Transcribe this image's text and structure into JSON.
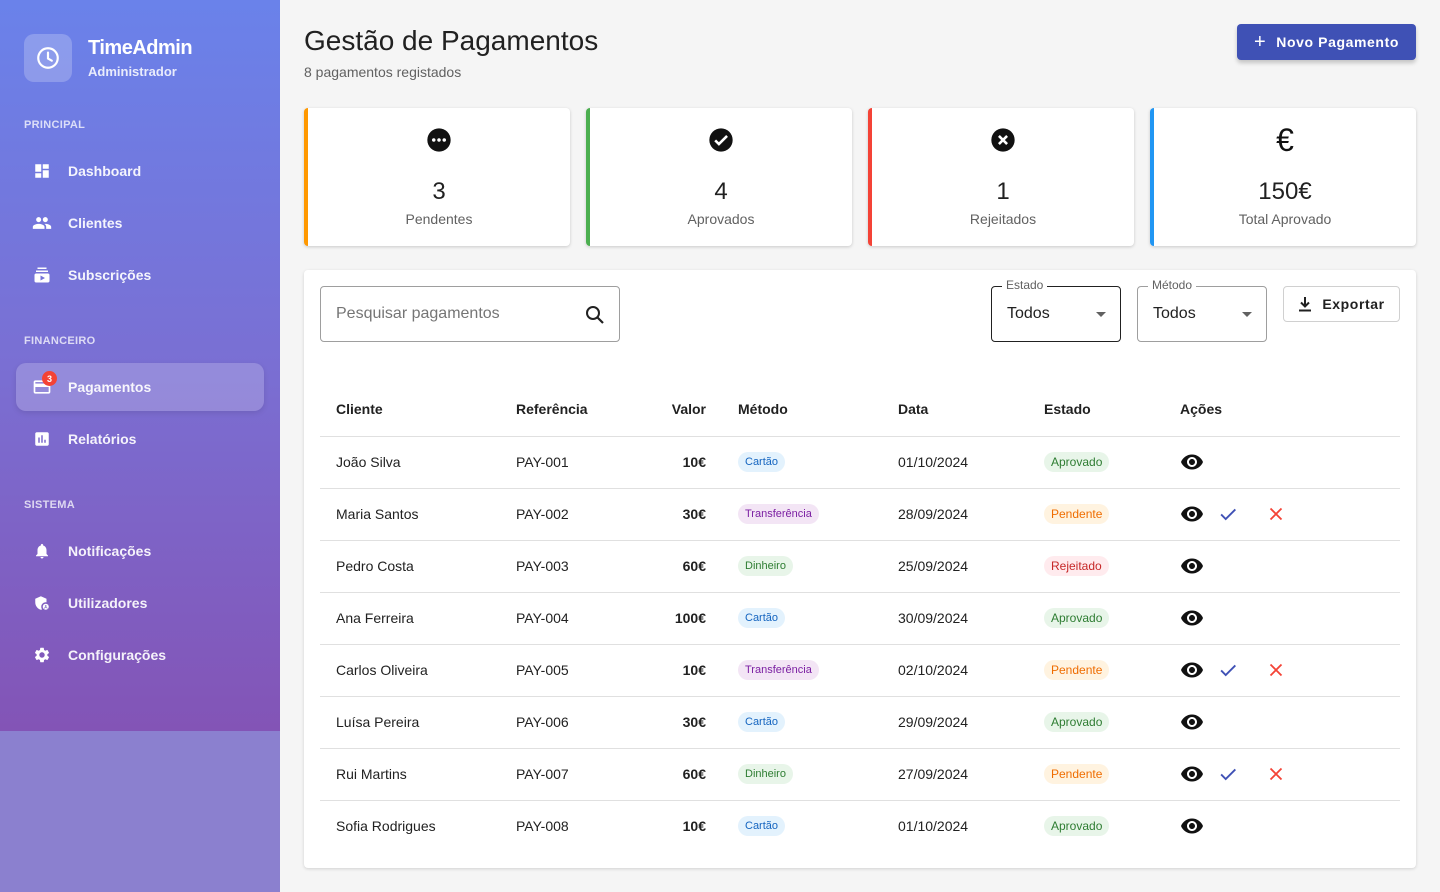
{
  "sidebar": {
    "brand_name": "TimeAdmin",
    "brand_role": "Administrador",
    "sections": [
      "PRINCIPAL",
      "FINANCEIRO",
      "SISTEMA"
    ],
    "items": [
      {
        "label": "Dashboard",
        "icon": "dashboard-icon"
      },
      {
        "label": "Clientes",
        "icon": "people-icon"
      },
      {
        "label": "Subscrições",
        "icon": "subscriptions-icon"
      },
      {
        "label": "Pagamentos",
        "icon": "payment-card-icon",
        "badge": "3",
        "active": true
      },
      {
        "label": "Relatórios",
        "icon": "bar-chart-icon"
      },
      {
        "label": "Notificações",
        "icon": "bell-icon"
      },
      {
        "label": "Utilizadores",
        "icon": "admin-user-icon"
      },
      {
        "label": "Configurações",
        "icon": "gear-icon"
      }
    ]
  },
  "header": {
    "title": "Gestão de Pagamentos",
    "subtitle": "8 pagamentos registados",
    "new_button": "Novo Pagamento"
  },
  "stats": [
    {
      "value": "3",
      "label": "Pendentes",
      "color": "#ff9800",
      "icon": "more-circle-icon"
    },
    {
      "value": "4",
      "label": "Aprovados",
      "color": "#4caf50",
      "icon": "check-circle-icon"
    },
    {
      "value": "1",
      "label": "Rejeitados",
      "color": "#f44336",
      "icon": "cancel-circle-icon"
    },
    {
      "value": "150€",
      "label": "Total Aprovado",
      "color": "#2196f3",
      "icon": "euro-icon"
    }
  ],
  "filters": {
    "search_placeholder": "Pesquisar pagamentos",
    "estado_label": "Estado",
    "estado_value": "Todos",
    "metodo_label": "Método",
    "metodo_value": "Todos",
    "export_label": "Exportar"
  },
  "table": {
    "columns": [
      "Cliente",
      "Referência",
      "Valor",
      "Método",
      "Data",
      "Estado",
      "Ações"
    ],
    "rows": [
      {
        "cliente": "João Silva",
        "ref": "PAY-001",
        "valor": "10€",
        "metodo": "Cartão",
        "data": "01/10/2024",
        "estado": "Aprovado"
      },
      {
        "cliente": "Maria Santos",
        "ref": "PAY-002",
        "valor": "30€",
        "metodo": "Transferência",
        "data": "28/09/2024",
        "estado": "Pendente"
      },
      {
        "cliente": "Pedro Costa",
        "ref": "PAY-003",
        "valor": "60€",
        "metodo": "Dinheiro",
        "data": "25/09/2024",
        "estado": "Rejeitado"
      },
      {
        "cliente": "Ana Ferreira",
        "ref": "PAY-004",
        "valor": "100€",
        "metodo": "Cartão",
        "data": "30/09/2024",
        "estado": "Aprovado"
      },
      {
        "cliente": "Carlos Oliveira",
        "ref": "PAY-005",
        "valor": "10€",
        "metodo": "Transferência",
        "data": "02/10/2024",
        "estado": "Pendente"
      },
      {
        "cliente": "Luísa Pereira",
        "ref": "PAY-006",
        "valor": "30€",
        "metodo": "Cartão",
        "data": "29/09/2024",
        "estado": "Aprovado"
      },
      {
        "cliente": "Rui Martins",
        "ref": "PAY-007",
        "valor": "60€",
        "metodo": "Dinheiro",
        "data": "27/09/2024",
        "estado": "Pendente"
      },
      {
        "cliente": "Sofia Rodrigues",
        "ref": "PAY-008",
        "valor": "10€",
        "metodo": "Cartão",
        "data": "01/10/2024",
        "estado": "Aprovado"
      }
    ]
  },
  "colors": {
    "primary": "#3f51b5",
    "approve": "#3f51b5",
    "reject": "#f44336"
  }
}
